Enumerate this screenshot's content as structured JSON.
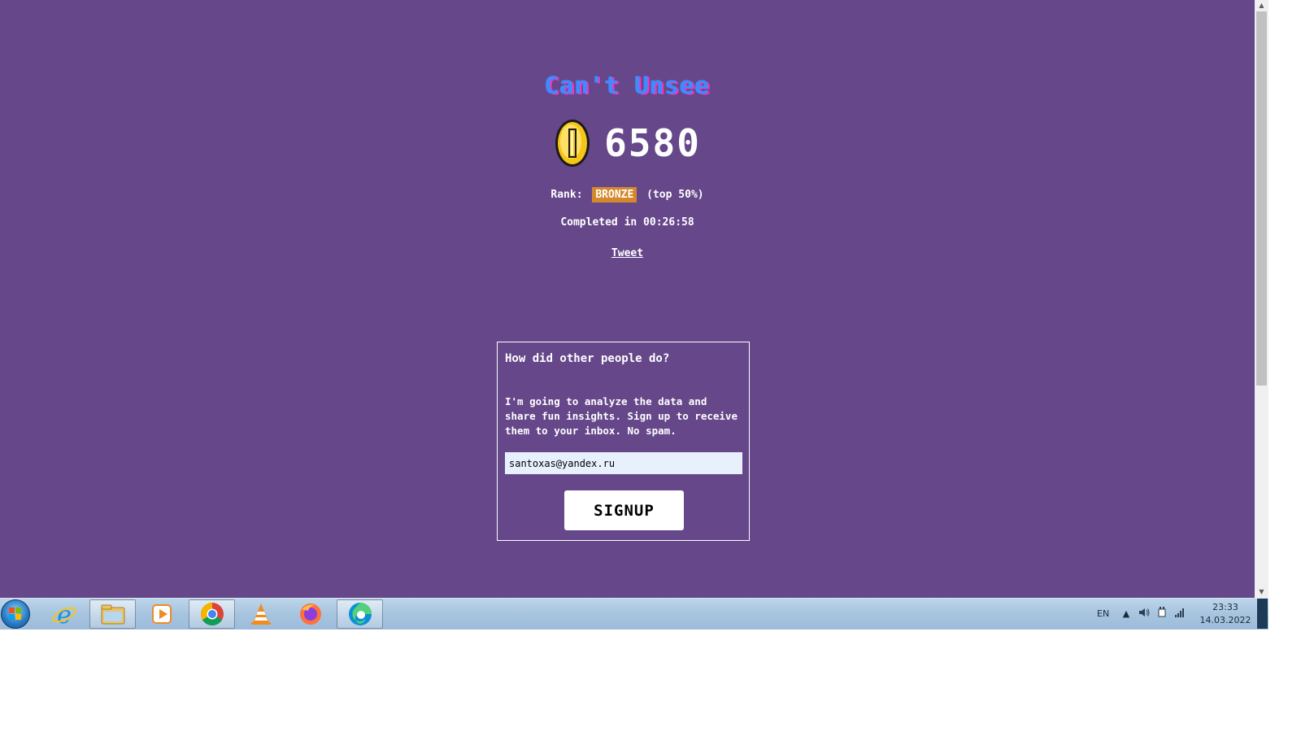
{
  "game": {
    "title": "Can't Unsee",
    "score": "6580",
    "rank_label": "Rank:",
    "rank_badge": "BRONZE",
    "rank_percentile": "(top 50%)",
    "completed": "Completed in 00:26:58",
    "tweet_link": "Tweet"
  },
  "signup": {
    "heading": "How did other people do?",
    "description": "I'm going to analyze the data and share fun insights. Sign up to receive them to your inbox. No spam.",
    "email_value": "santoxas@yandex.ru",
    "button_label": "SIGNUP"
  },
  "colors": {
    "page_background": "#65478a",
    "title_blue": "#3d8bff",
    "title_pink": "#ff2fb4",
    "bronze": "#d4882c",
    "coin_gold": "#f5c518"
  },
  "taskbar": {
    "apps": [
      {
        "name": "internet-explorer-icon",
        "active": false
      },
      {
        "name": "file-explorer-icon",
        "active": true
      },
      {
        "name": "media-player-icon",
        "active": false
      },
      {
        "name": "chrome-icon",
        "active": true
      },
      {
        "name": "vlc-icon",
        "active": false
      },
      {
        "name": "firefox-icon",
        "active": false
      },
      {
        "name": "edge-icon",
        "active": true
      }
    ],
    "language": "EN",
    "time": "23:33",
    "date": "14.03.2022"
  }
}
